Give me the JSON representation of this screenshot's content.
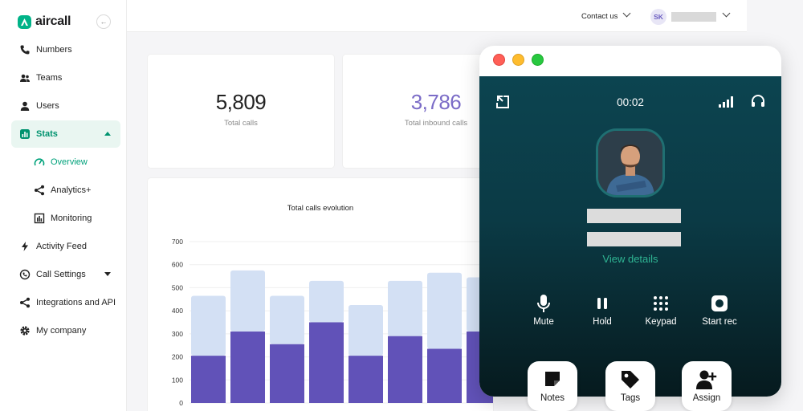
{
  "brand": {
    "name": "aircall",
    "accent": "#00b388"
  },
  "sidebar": {
    "items": [
      {
        "label": "Numbers",
        "icon": "phone-icon"
      },
      {
        "label": "Teams",
        "icon": "teams-icon"
      },
      {
        "label": "Users",
        "icon": "user-icon"
      },
      {
        "label": "Stats",
        "icon": "stats-icon"
      },
      {
        "label": "Overview",
        "icon": "gauge-icon"
      },
      {
        "label": "Analytics+",
        "icon": "share-icon"
      },
      {
        "label": "Monitoring",
        "icon": "monitor-icon"
      },
      {
        "label": "Activity Feed",
        "icon": "bolt-icon"
      },
      {
        "label": "Call Settings",
        "icon": "settings-icon"
      },
      {
        "label": "Integrations and API",
        "icon": "share-icon"
      },
      {
        "label": "My company",
        "icon": "gear-icon"
      }
    ]
  },
  "header": {
    "contact": "Contact us",
    "initials": "SK"
  },
  "stats": [
    {
      "value": "5,809",
      "label": "Total calls",
      "color": "#1d1d1f"
    },
    {
      "value": "3,786",
      "label": "Total inbound calls",
      "color": "#7b6cc7"
    }
  ],
  "chart_data": {
    "type": "bar",
    "title": "Total calls evolution",
    "yticks": [
      "0",
      "100",
      "200",
      "300",
      "400",
      "500",
      "600",
      "700"
    ],
    "ylim": [
      0,
      700
    ],
    "series": [
      {
        "color": "#6152b8",
        "values": [
          205,
          310,
          255,
          350,
          205,
          290,
          235,
          310
        ]
      },
      {
        "color": "#d3e0f4",
        "values": [
          260,
          265,
          210,
          180,
          220,
          240,
          330,
          235
        ]
      }
    ],
    "stacked": true
  },
  "call": {
    "timer": "00:02",
    "view_details": "View details",
    "controls": [
      "Mute",
      "Hold",
      "Keypad",
      "Start rec"
    ],
    "actions": [
      "Notes",
      "Tags",
      "Assign"
    ]
  }
}
